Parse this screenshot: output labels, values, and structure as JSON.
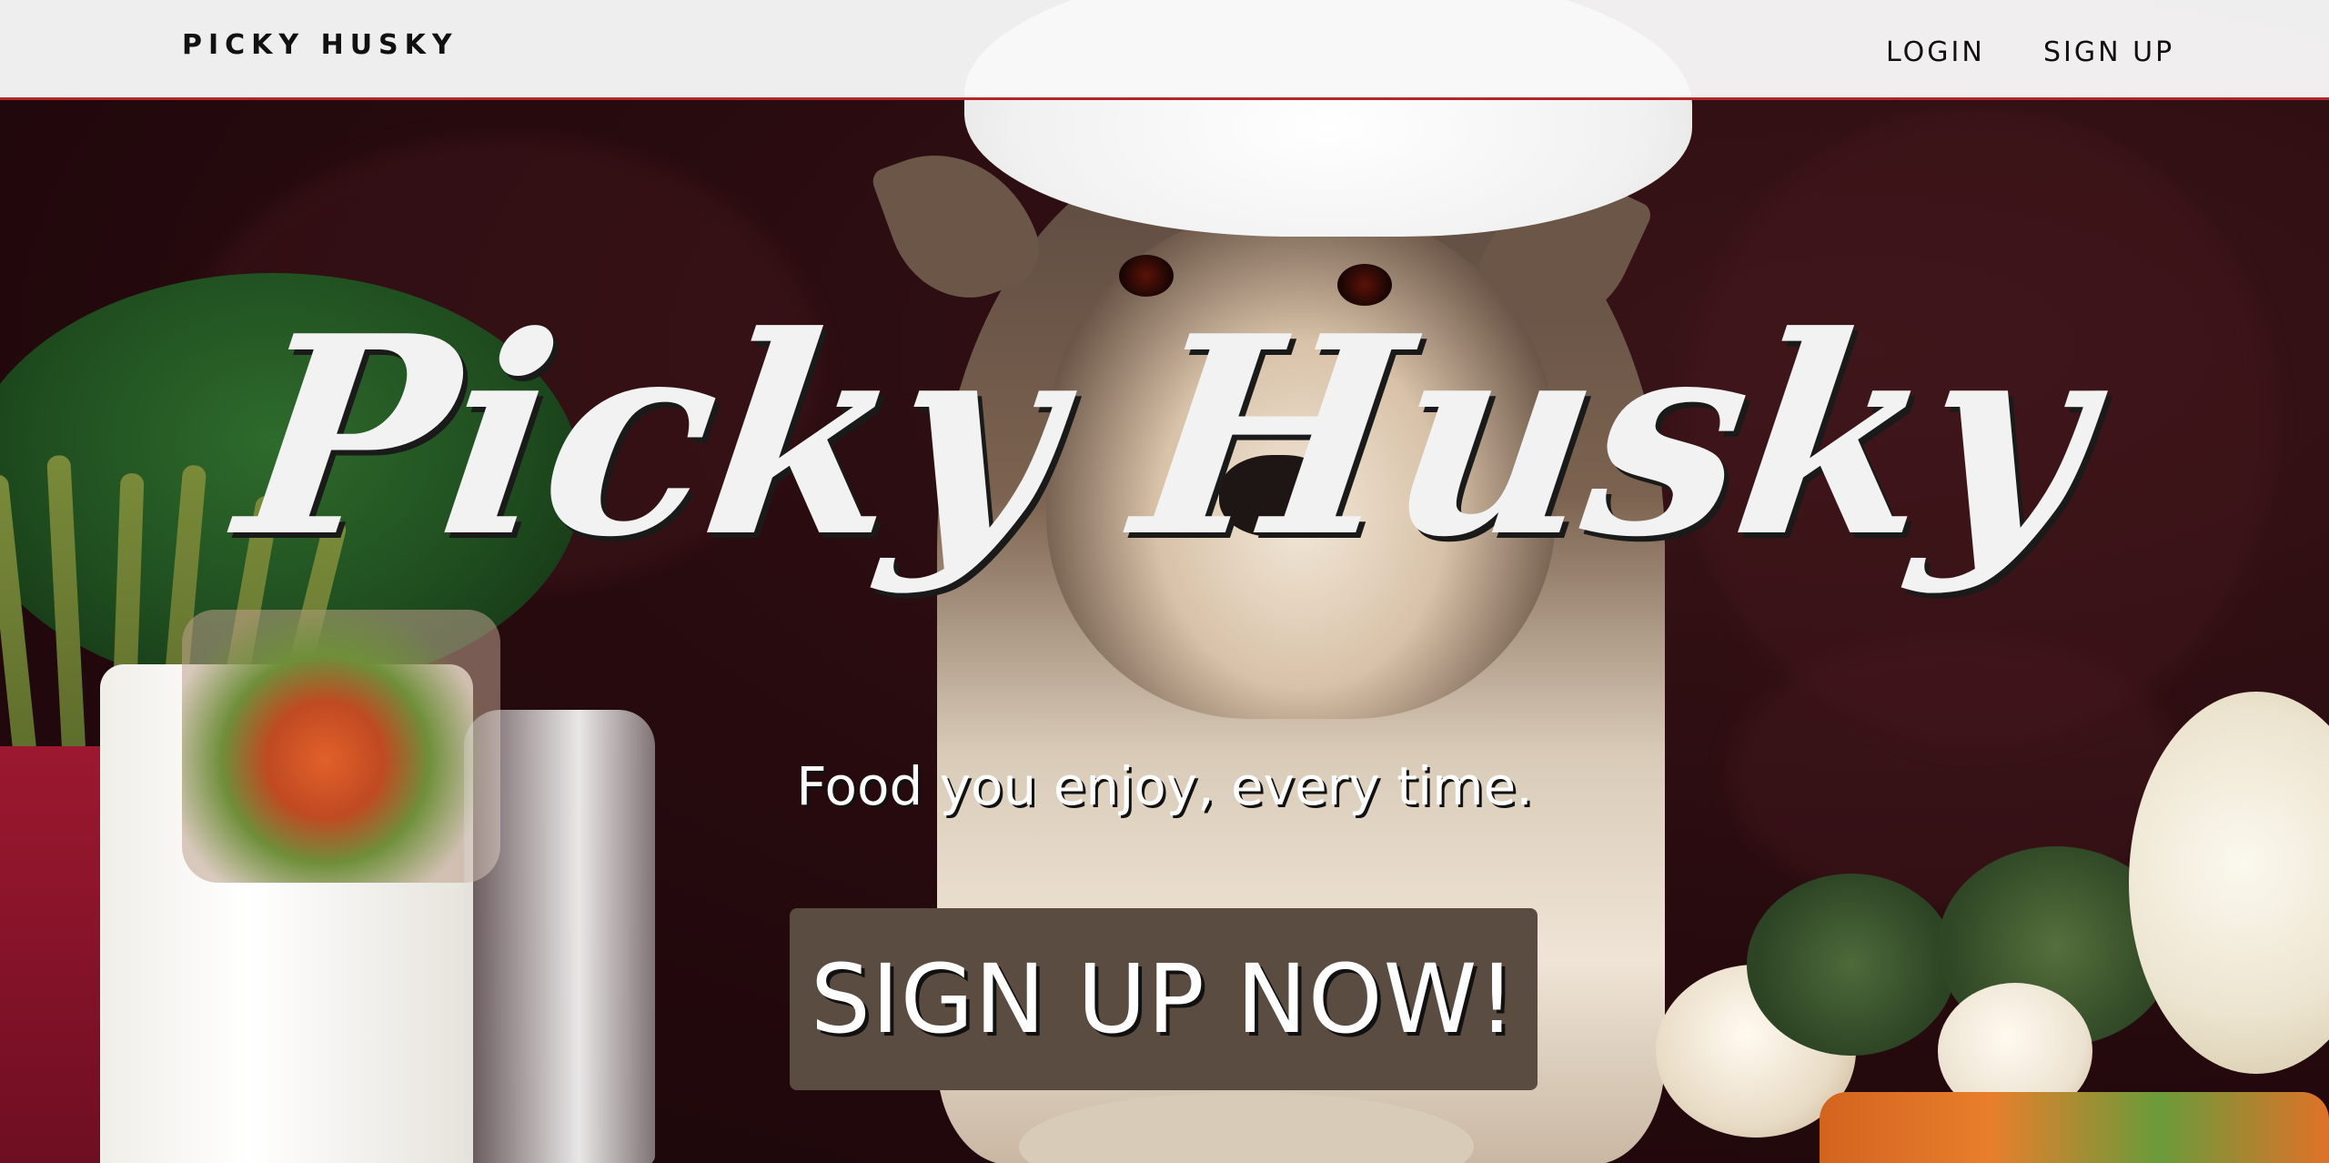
{
  "header": {
    "brand": "PICKY HUSKY",
    "nav": [
      {
        "label": "LOGIN"
      },
      {
        "label": "SIGN UP"
      }
    ]
  },
  "hero": {
    "title": "Picky Husky",
    "tagline": "Food you enjoy, every time.",
    "cta_label": "SIGN UP NOW!"
  },
  "colors": {
    "header_bg": "#f8f8f8",
    "header_border": "#b3272a",
    "cta_bg": "#5a4c40",
    "hero_text": "#f2f2f2"
  }
}
